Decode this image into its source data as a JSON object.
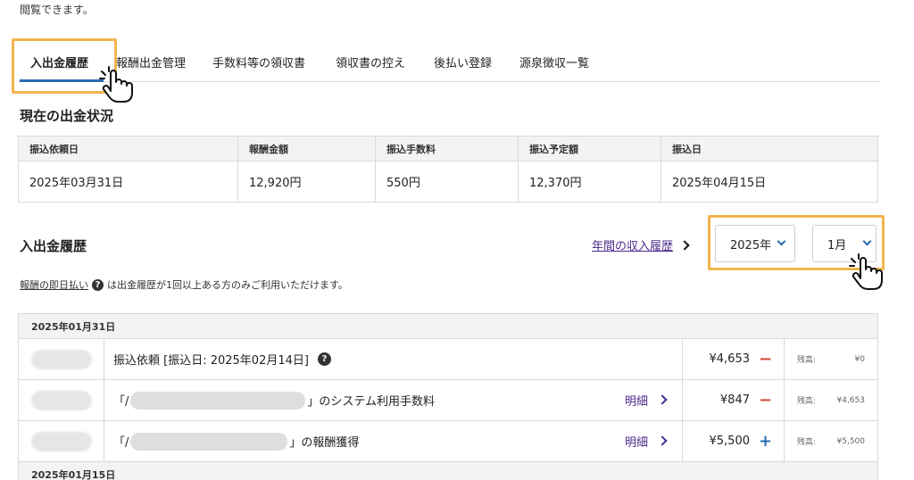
{
  "intro_text": "閲覧できます。",
  "tabs": [
    {
      "label": "入出金履歴"
    },
    {
      "label": "報酬出金管理"
    },
    {
      "label": "手数料等の領収書"
    },
    {
      "label": "領収書の控え"
    },
    {
      "label": "後払い登録"
    },
    {
      "label": "源泉徴収一覧"
    }
  ],
  "status": {
    "title": "現在の出金状況",
    "headers": [
      "振込依頼日",
      "報酬金額",
      "振込手数料",
      "振込予定額",
      "振込日"
    ],
    "row": [
      "2025年03月31日",
      "12,920円",
      "550円",
      "12,370円",
      "2025年04月15日"
    ]
  },
  "history": {
    "title": "入出金履歴",
    "annual_link": "年間の収入履歴",
    "year_select": "2025年",
    "month_select": "1月",
    "note_link": "報酬の即日払い",
    "note_help": "?",
    "note_text": "は出金履歴が1回以上ある方のみご利用いただけます。",
    "groups": [
      {
        "date": "2025年01月31日",
        "entries": [
          {
            "desc": "振込依頼 [振込日: 2025年02月14日]",
            "help": "?",
            "amount": "¥4,653",
            "sign": "−",
            "balance_label": "残高:",
            "balance": "¥0"
          },
          {
            "desc_prefix": "「/",
            "desc_suffix": "」のシステム利用手数料",
            "detail": "明細",
            "amount": "¥847",
            "sign": "−",
            "balance_label": "残高:",
            "balance": "¥4,653"
          },
          {
            "desc_prefix": "「/",
            "desc_suffix": "」の報酬獲得",
            "detail": "明細",
            "amount": "¥5,500",
            "sign": "+",
            "balance_label": "残高:",
            "balance": "¥5,500"
          }
        ]
      },
      {
        "date": "2025年01月15日"
      }
    ]
  },
  "colors": {
    "accent": "#2b6cb0",
    "highlight": "#f2b54c",
    "link": "#4a2a8a",
    "minus": "#d94a3a"
  }
}
